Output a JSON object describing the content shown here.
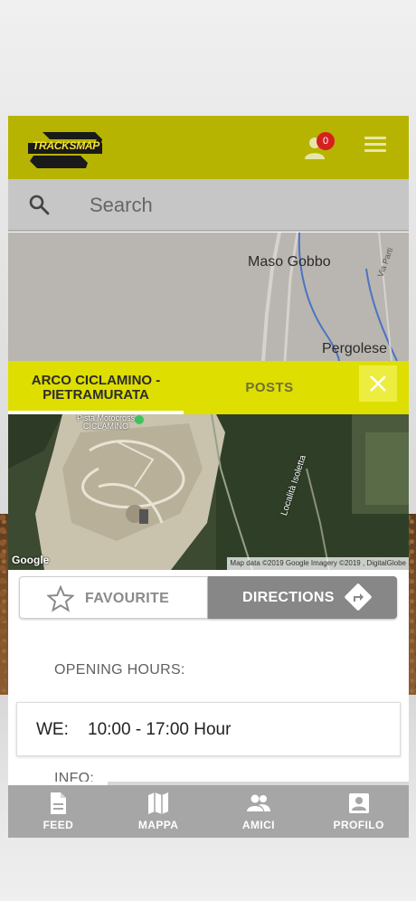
{
  "app": {
    "logo_text": "TRACKSMAP",
    "notification_count": "0"
  },
  "search": {
    "placeholder": "Search"
  },
  "map": {
    "places": [
      "Maso Gobbo",
      "Pergolese",
      "Via Parti"
    ]
  },
  "track_panel": {
    "tab_track_label": "ARCO CICLAMINO - PIETRAMURATA",
    "tab_posts_label": "POSTS"
  },
  "satellite": {
    "place_label": "Pista Motocross CICLAMINO",
    "road_label": "Località Isoletta",
    "google_label": "Google",
    "attribution": "Map data ©2019 Google  Imagery ©2019 , DigitalGlobe"
  },
  "actions": {
    "favourite_label": "FAVOURITE",
    "directions_label": "DIRECTIONS"
  },
  "opening_hours": {
    "heading": "OPENING HOURS:",
    "rows": [
      {
        "day": "WE:",
        "time": "10:00 - 17:00 Hour"
      }
    ]
  },
  "info": {
    "heading": "INFO:"
  },
  "bottom_nav": {
    "items": [
      {
        "label": "FEED",
        "icon": "document-icon"
      },
      {
        "label": "MAPPA",
        "icon": "map-icon"
      },
      {
        "label": "AMICI",
        "icon": "people-icon"
      },
      {
        "label": "PROFILO",
        "icon": "profile-icon"
      }
    ]
  },
  "colors": {
    "topbar": "#b6b401",
    "tabs": "#dede00",
    "directions_button": "#878787",
    "badge": "#d62020"
  }
}
